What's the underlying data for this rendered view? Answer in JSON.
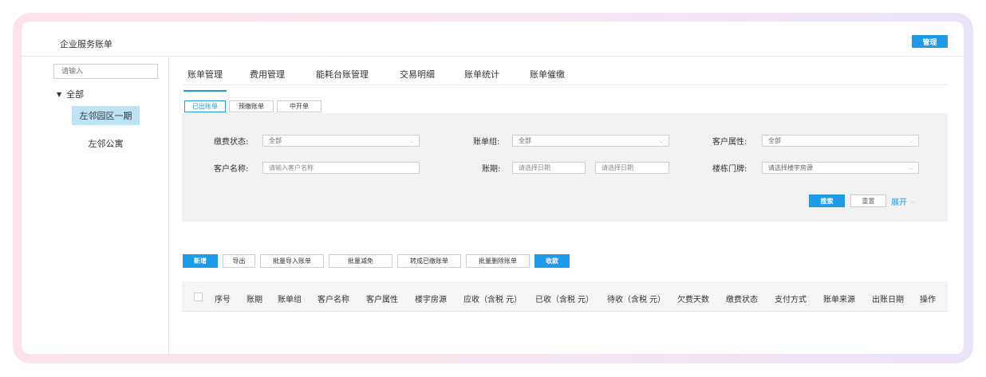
{
  "app": {
    "title": "企业服务账单",
    "manage_label": "管理"
  },
  "sidebar": {
    "search_placeholder": "请输入",
    "root_label": "全部",
    "items": [
      {
        "label": "左邻园区一期",
        "active": true
      },
      {
        "label": "左邻公寓",
        "active": false
      }
    ]
  },
  "tabs": [
    {
      "label": "账单管理",
      "active": true
    },
    {
      "label": "费用管理",
      "active": false
    },
    {
      "label": "能耗台账管理",
      "active": false
    },
    {
      "label": "交易明细",
      "active": false
    },
    {
      "label": "账单统计",
      "active": false
    },
    {
      "label": "账单催缴",
      "active": false
    }
  ],
  "subtabs": [
    {
      "label": "已出账单",
      "active": true
    },
    {
      "label": "预缴账单",
      "active": false
    },
    {
      "label": "中开单",
      "active": false
    }
  ],
  "filters": {
    "pay_status_label": "缴费状态:",
    "pay_status_value": "全部",
    "bill_group_label": "账单组:",
    "bill_group_value": "全部",
    "customer_attr_label": "客户属性:",
    "customer_attr_value": "全部",
    "customer_name_label": "客户名称:",
    "customer_name_placeholder": "请输入客户名称",
    "period_label": "账期:",
    "period_start_placeholder": "请选择日期",
    "period_end_placeholder": "请选择日期",
    "building_label": "楼栋门牌:",
    "building_placeholder": "请选择楼宇房源",
    "search_label": "搜索",
    "reset_label": "重置",
    "expand_label": "展开"
  },
  "actions": [
    "新增",
    "导出",
    "批量导入账单",
    "批量减免",
    "转成已缴账单",
    "批量删除账单",
    "收款"
  ],
  "table": {
    "columns": [
      "序号",
      "账期",
      "账单组",
      "客户名称",
      "客户属性",
      "楼宇房源",
      "应收（含税 元）",
      "已收（含税 元）",
      "待收（含税 元）",
      "欠费天数",
      "缴费状态",
      "支付方式",
      "账单来源",
      "出账日期",
      "操作"
    ]
  },
  "colors": {
    "accent": "#1e9be8",
    "tree_active_bg": "#bde3f7",
    "panel_bg": "#f2f2f2"
  }
}
